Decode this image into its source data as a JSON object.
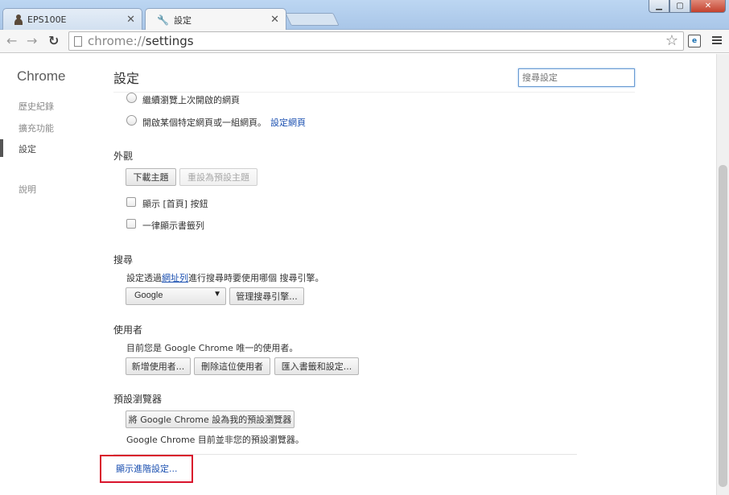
{
  "tabs": [
    {
      "title": "EPS100E",
      "active": false
    },
    {
      "title": "設定",
      "active": true
    }
  ],
  "toolbar": {
    "url_scheme": "chrome://",
    "url_path": "settings"
  },
  "sidebar": {
    "title": "Chrome",
    "items": [
      {
        "label": "歷史紀錄"
      },
      {
        "label": "擴充功能"
      },
      {
        "label": "設定"
      },
      {
        "label": "說明"
      }
    ]
  },
  "header": {
    "title": "設定",
    "search_placeholder": "搜尋設定"
  },
  "startup": {
    "option_continue": "繼續瀏覽上次開啟的網頁",
    "option_specific": "開啟某個特定網頁或一組網頁。",
    "set_pages_link": "設定網頁"
  },
  "appearance": {
    "title": "外觀",
    "get_themes": "下載主題",
    "reset_theme": "重設為預設主題",
    "show_home": "顯示 [首頁] 按鈕",
    "show_bookmarks": "一律顯示書籤列"
  },
  "search": {
    "title": "搜尋",
    "desc_before": "設定透過",
    "desc_link": "網址列",
    "desc_after": "進行搜尋時要使用哪個 搜尋引擎。",
    "engine": "Google",
    "manage": "管理搜尋引擎..."
  },
  "users": {
    "title": "使用者",
    "desc": "目前您是 Google Chrome 唯一的使用者。",
    "add": "新增使用者...",
    "delete": "刪除這位使用者",
    "import": "匯入書籤和設定..."
  },
  "default_browser": {
    "title": "預設瀏覽器",
    "make_default": "將 Google Chrome 設為我的預設瀏覽器",
    "status": "Google Chrome 目前並非您的預設瀏覽器。"
  },
  "advanced_link": "顯示進階設定..."
}
